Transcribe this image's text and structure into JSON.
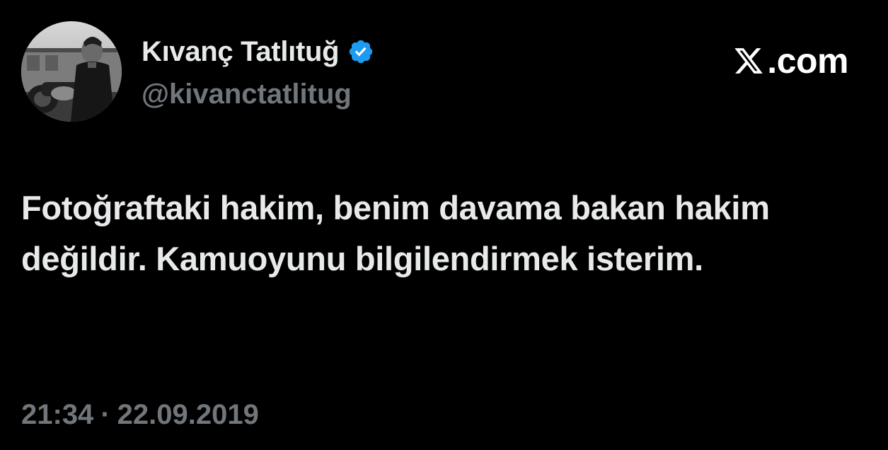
{
  "tweet": {
    "author": {
      "display_name": "Kıvanç Tatlıtuğ",
      "handle": "@kivanctatlitug",
      "verified": true,
      "verified_color": "#1d9bf0",
      "avatar_icon": "profile-photo-grayscale"
    },
    "brand": {
      "logo_icon": "x-logo-icon",
      "domain": ".com"
    },
    "text": "Fotoğraftaki hakim, benim davama bakan hakim değildir. Kamuoyunu bilgilendirmek isterim.",
    "timestamp": {
      "time": "21:34",
      "separator": "·",
      "date": "22.09.2019"
    }
  },
  "colors": {
    "background": "#000000",
    "primary_text": "#e7e9ea",
    "secondary_text": "#71767b",
    "accent": "#1d9bf0"
  }
}
